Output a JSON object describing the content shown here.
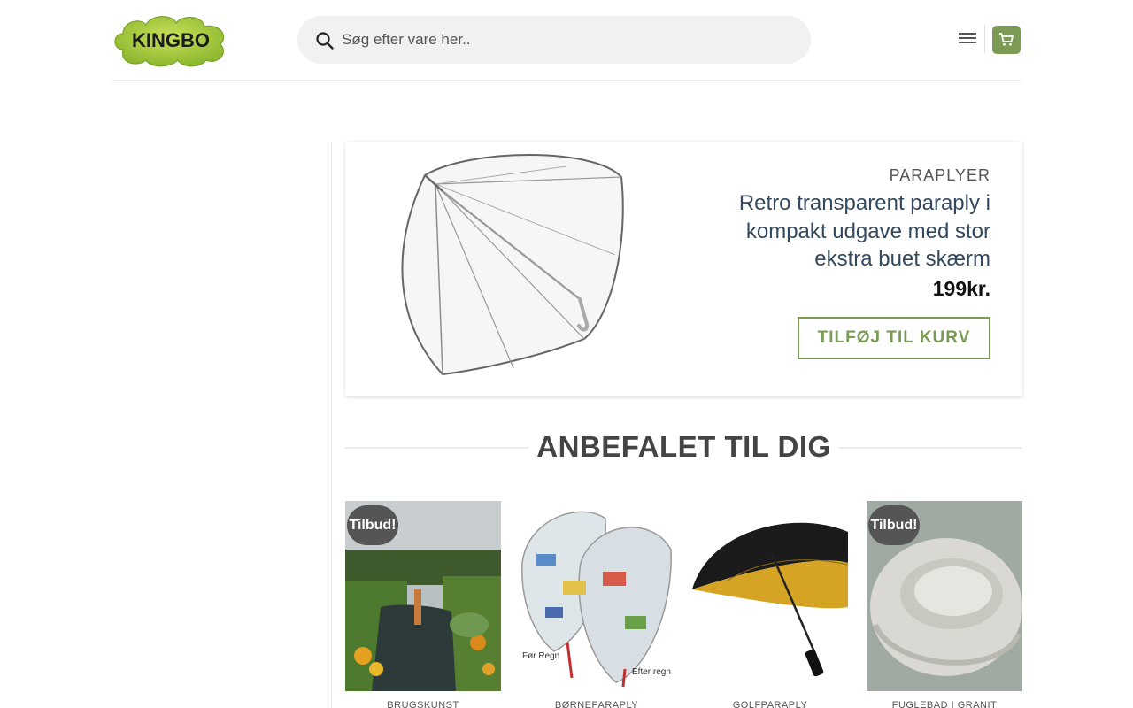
{
  "header": {
    "logo_text": "KINGBO",
    "search": {
      "placeholder": "Søg efter vare her.."
    },
    "icons": {
      "search": "search-icon",
      "menu": "hamburger-menu-icon",
      "cart": "shopping-cart-icon"
    }
  },
  "colors": {
    "accent": "#7a9a56",
    "title": "#34495e",
    "badge": "#555555"
  },
  "featured": {
    "category": "PARAPLYER",
    "title": "Retro transparent paraply i kompakt udgave med stor ekstra buet skærm",
    "price": "199kr.",
    "button_label": "TILFØJ TIL KURV"
  },
  "recommended": {
    "heading": "ANBEFALET TIL DIG",
    "products": [
      {
        "badge": "Tilbud!",
        "category": "BRUGSKUNST"
      },
      {
        "badge": "",
        "category": "BØRNEPARAPLY",
        "image_text_before": "Før Regn",
        "image_text_after": "Efter regn"
      },
      {
        "badge": "",
        "category": "GOLFPARAPLY"
      },
      {
        "badge": "Tilbud!",
        "category": "FUGLEBAD I GRANIT"
      }
    ]
  }
}
